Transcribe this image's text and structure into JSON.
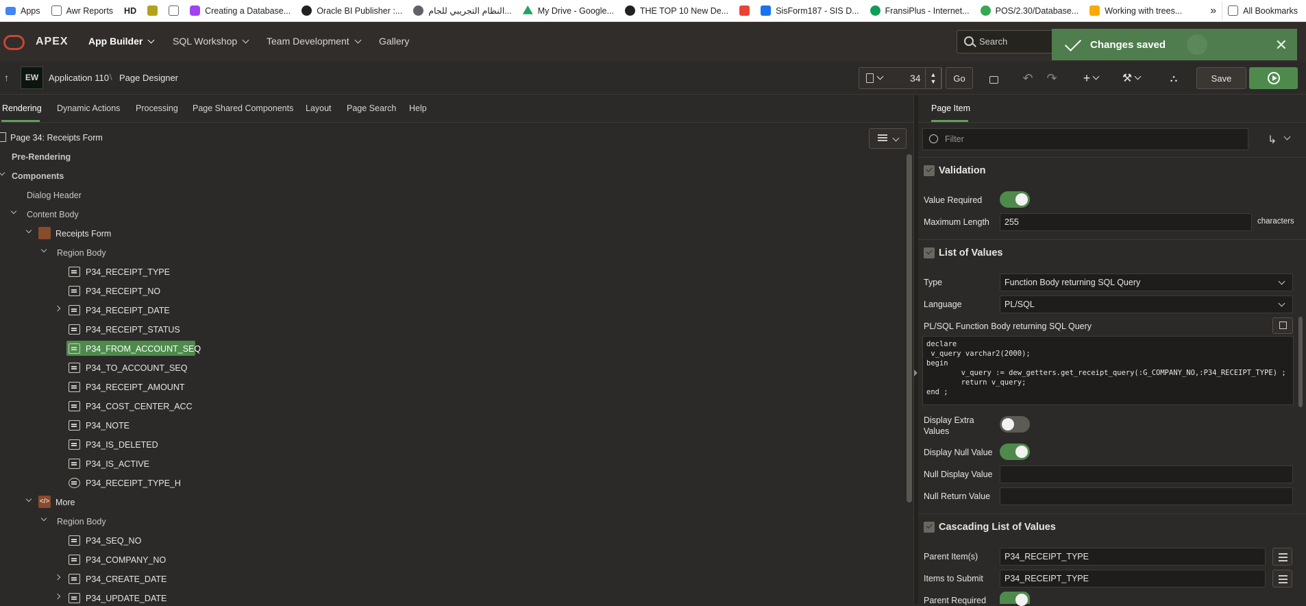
{
  "bookmarks": [
    {
      "label": "Apps",
      "color": "#4285f4"
    },
    {
      "label": "Awr Reports",
      "color": "#5f6368"
    },
    {
      "label": "HD",
      "color": "#202124"
    },
    {
      "label": "",
      "color": "#b5a21c"
    },
    {
      "label": "",
      "color": "#5f6368"
    },
    {
      "label": "Creating a Database...",
      "color": "#a142f4"
    },
    {
      "label": "Oracle BI Publisher :...",
      "color": "#202124"
    },
    {
      "label": "النظام التجريبي للجام...",
      "color": "#5f6368"
    },
    {
      "label": "My Drive - Google...",
      "color": "#1fa463"
    },
    {
      "label": "THE TOP 10 New De...",
      "color": "#202124"
    },
    {
      "label": "",
      "color": "#ea4335"
    },
    {
      "label": "SisForm187 - SIS D...",
      "color": "#1a73e8"
    },
    {
      "label": "FransiPlus - Internet...",
      "color": "#0f9d58"
    },
    {
      "label": "POS/2.30/Database...",
      "color": "#34a853"
    },
    {
      "label": "Working with trees...",
      "color": "#f9ab00"
    }
  ],
  "bookmarks_more": "»",
  "all_bookmarks": "All Bookmarks",
  "header": {
    "brand": "APEX",
    "nav": [
      "App Builder",
      "SQL Workshop",
      "Team Development",
      "Gallery"
    ],
    "search_placeholder": "Search"
  },
  "toast": {
    "message": "Changes saved",
    "close": "✕"
  },
  "designer": {
    "app_label": "Application 110",
    "separator": "\\",
    "page_designer": "Page Designer",
    "page_number": "34",
    "go": "Go",
    "save": "Save"
  },
  "tabs": [
    "Rendering",
    "Dynamic Actions",
    "Processing",
    "Page Shared Components",
    "Layout",
    "Page Search",
    "Help"
  ],
  "tree": {
    "page": "Page 34: Receipts Form",
    "pre_rendering": "Pre-Rendering",
    "components": "Components",
    "dialog_header": "Dialog Header",
    "content_body": "Content Body",
    "receipts_form": "Receipts Form",
    "region_body_1": "Region Body",
    "items": [
      "P34_RECEIPT_TYPE",
      "P34_RECEIPT_NO",
      "P34_RECEIPT_DATE",
      "P34_RECEIPT_STATUS",
      "P34_FROM_ACCOUNT_SEQ",
      "P34_TO_ACCOUNT_SEQ",
      "P34_RECEIPT_AMOUNT",
      "P34_COST_CENTER_ACC",
      "P34_NOTE",
      "P34_IS_DELETED",
      "P34_IS_ACTIVE",
      "P34_RECEIPT_TYPE_H"
    ],
    "more": "More",
    "region_body_2": "Region Body",
    "more_items": [
      "P34_SEQ_NO",
      "P34_COMPANY_NO",
      "P34_CREATE_DATE",
      "P34_UPDATE_DATE"
    ]
  },
  "property_panel": {
    "tab": "Page Item",
    "filter_placeholder": "Filter",
    "validation": {
      "title": "Validation",
      "value_required": "Value Required",
      "max_length_label": "Maximum Length",
      "max_length": "255",
      "max_length_unit": "characters"
    },
    "lov": {
      "title": "List of Values",
      "type_label": "Type",
      "type": "Function Body returning SQL Query",
      "language_label": "Language",
      "language": "PL/SQL",
      "code_label": "PL/SQL Function Body returning SQL Query",
      "code": "declare\n v_query varchar2(2000);\nbegin\n        v_query := dew_getters.get_receipt_query(:G_COMPANY_NO,:P34_RECEIPT_TYPE) ;\n        return v_query;\nend ;",
      "display_extra_label": "Display Extra Values",
      "display_null_label": "Display Null Value",
      "null_display_label": "Null Display Value",
      "null_display": "",
      "null_return_label": "Null Return Value",
      "null_return": ""
    },
    "cascading": {
      "title": "Cascading List of Values",
      "parent_items_label": "Parent Item(s)",
      "parent_items": "P34_RECEIPT_TYPE",
      "items_to_submit_label": "Items to Submit",
      "items_to_submit": "P34_RECEIPT_TYPE",
      "parent_required_label": "Parent Required"
    }
  }
}
